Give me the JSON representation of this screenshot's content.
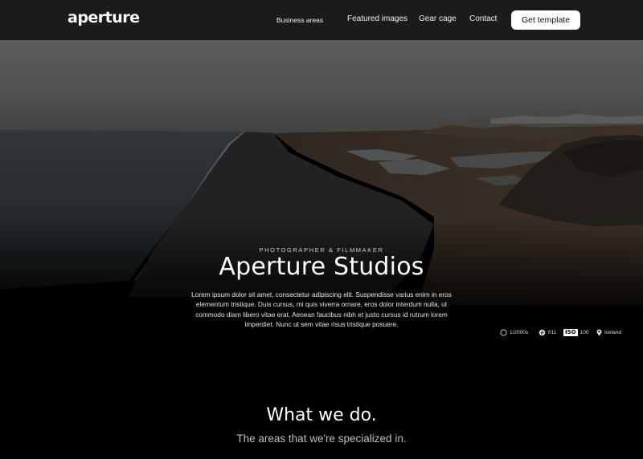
{
  "nav": {
    "logo": "aperture",
    "links": [
      "Business areas",
      "Featured images",
      "Gear cage",
      "Contact"
    ],
    "cta": "Get template"
  },
  "hero": {
    "eyebrow": "PHOTOGRAPHER & FILMMAKER",
    "title": "Aperture Studios",
    "body": "Lorem ipsum dolor sit amet, consectetur adipiscing elit. Suspendisse varius enim in eros elementum tristique. Duis cursus, mi quis viverra ornare, eros dolor interdum nulla, ut commodo diam libero vitae erat. Aenean faucibus nibh et justo cursus id rutrum lorem imperdiet. Nunc ut sem vitae risus tristique posuere.",
    "specs": {
      "shutter": "1/2000s",
      "aperture": "f/11",
      "iso_label": "ISO",
      "iso_value": "100",
      "location": "Iceland"
    }
  },
  "section": {
    "title": "What we do.",
    "subtitle": "The areas that we're specialized in."
  },
  "colors": {
    "nav_bg": "#1b1b1b",
    "page_bg": "#000000",
    "cta_bg": "#ffffff",
    "cta_text": "#111111"
  }
}
